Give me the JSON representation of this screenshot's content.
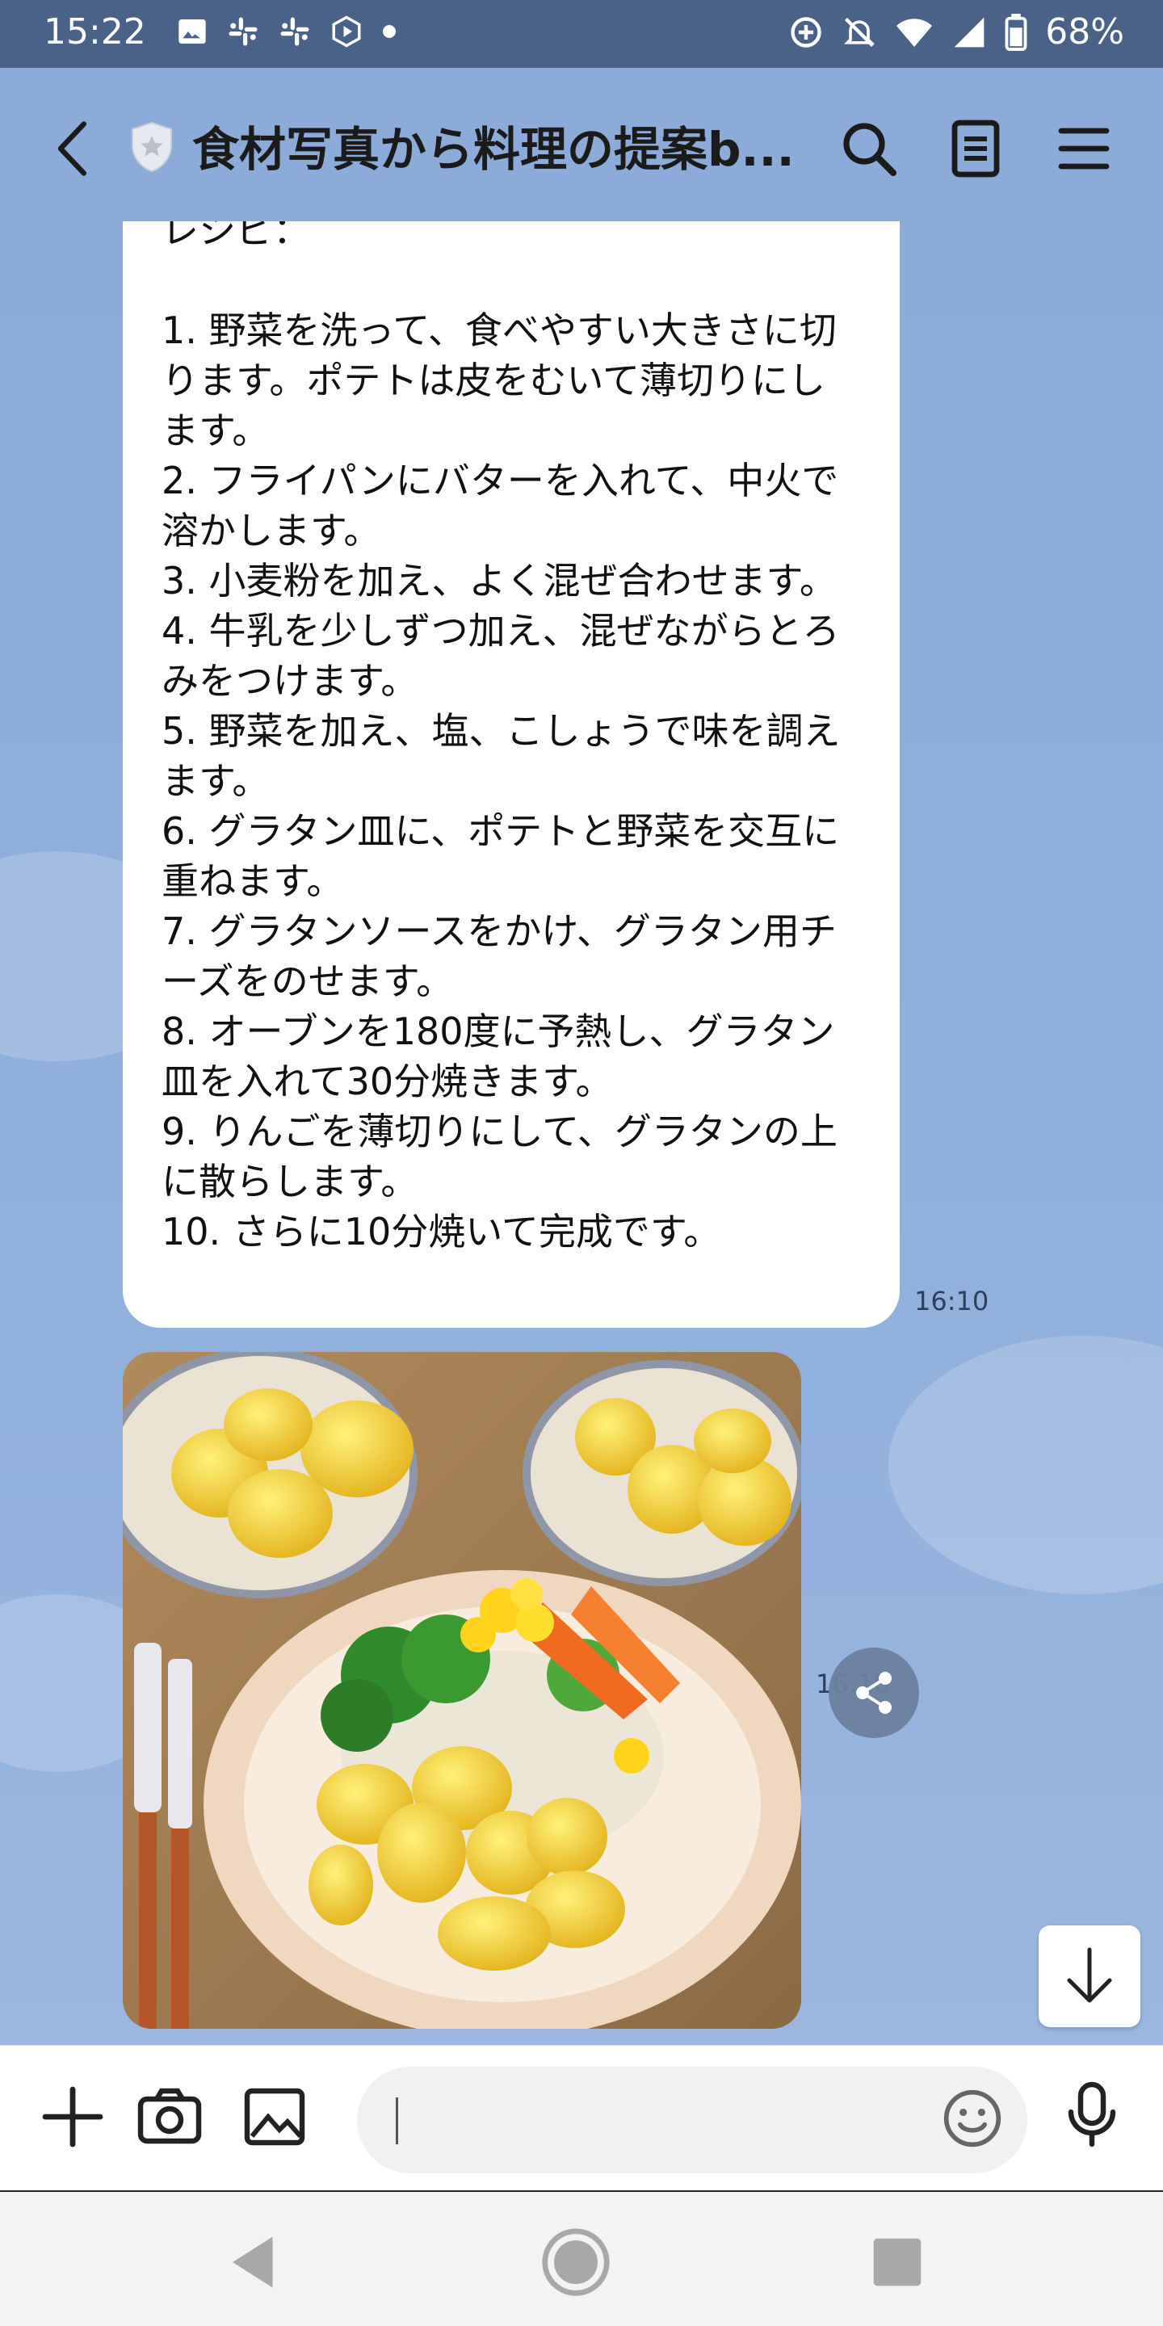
{
  "status_bar": {
    "time": "15:22",
    "battery": "68%",
    "icons_left": [
      "image-icon",
      "slack-icon",
      "slack-icon",
      "play-icon",
      "dot-icon"
    ],
    "icons_right": [
      "sync-icon",
      "mute-icon",
      "wifi-icon",
      "signal-icon",
      "battery-icon"
    ]
  },
  "header": {
    "title": "食材写真から料理の提案b...",
    "actions": [
      "search-icon",
      "notes-icon",
      "menu-icon"
    ]
  },
  "message": {
    "text": "レシピ：\n\n1. 野菜を洗って、食べやすい大きさに切ります。ポテトは皮をむいて薄切りにします。\n2. フライパンにバターを入れて、中火で溶かします。\n3. 小麦粉を加え、よく混ぜ合わせます。\n4. 牛乳を少しずつ加え、混ぜながらとろみをつけます。\n5. 野菜を加え、塩、こしょうで味を調えます。\n6. グラタン皿に、ポテトと野菜を交互に重ねます。\n7. グラタンソースをかけ、グラタン用チーズをのせます。\n8. オーブンを180度に予熱し、グラタン皿を入れて30分焼きます。\n9. りんごを薄切りにして、グラタンの上に散らします。\n10. さらに10分焼いて完成です。",
    "time": "16:10"
  },
  "image_message": {
    "time": "16:10",
    "description_icon": "food-photo-icon"
  },
  "input_bar": {
    "placeholder": "",
    "value": ""
  },
  "colors": {
    "chat_background": "#8dabd9",
    "status_bar": "#4a6188",
    "bubble": "#ffffff"
  }
}
